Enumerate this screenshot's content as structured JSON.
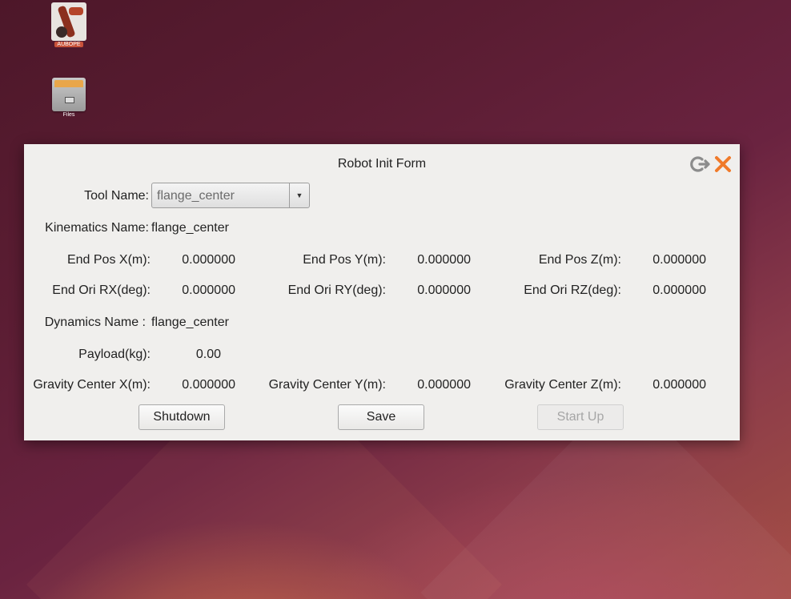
{
  "desktop": {
    "icons": [
      {
        "label": "AUBOPE"
      },
      {
        "label": "Files"
      }
    ]
  },
  "dialog": {
    "title": "Robot Init Form",
    "tool_name": {
      "label": "Tool Name:",
      "value": "flange_center"
    },
    "kinematics_name": {
      "label": "Kinematics Name:",
      "value": "flange_center"
    },
    "end_pos": [
      {
        "label": "End Pos X(m):",
        "value": "0.000000"
      },
      {
        "label": "End Pos Y(m):",
        "value": "0.000000"
      },
      {
        "label": "End Pos Z(m):",
        "value": "0.000000"
      }
    ],
    "end_ori": [
      {
        "label": "End Ori RX(deg):",
        "value": "0.000000"
      },
      {
        "label": "End Ori RY(deg):",
        "value": "0.000000"
      },
      {
        "label": "End Ori RZ(deg):",
        "value": "0.000000"
      }
    ],
    "dynamics_name": {
      "label": "Dynamics Name :",
      "value": "flange_center"
    },
    "payload": {
      "label": "Payload(kg):",
      "value": "0.00"
    },
    "gravity": [
      {
        "label": "Gravity Center X(m):",
        "value": "0.000000"
      },
      {
        "label": "Gravity Center Y(m):",
        "value": "0.000000"
      },
      {
        "label": "Gravity Center Z(m):",
        "value": "0.000000"
      }
    ],
    "buttons": {
      "shutdown": "Shutdown",
      "save": "Save",
      "start_up": "Start Up"
    }
  }
}
